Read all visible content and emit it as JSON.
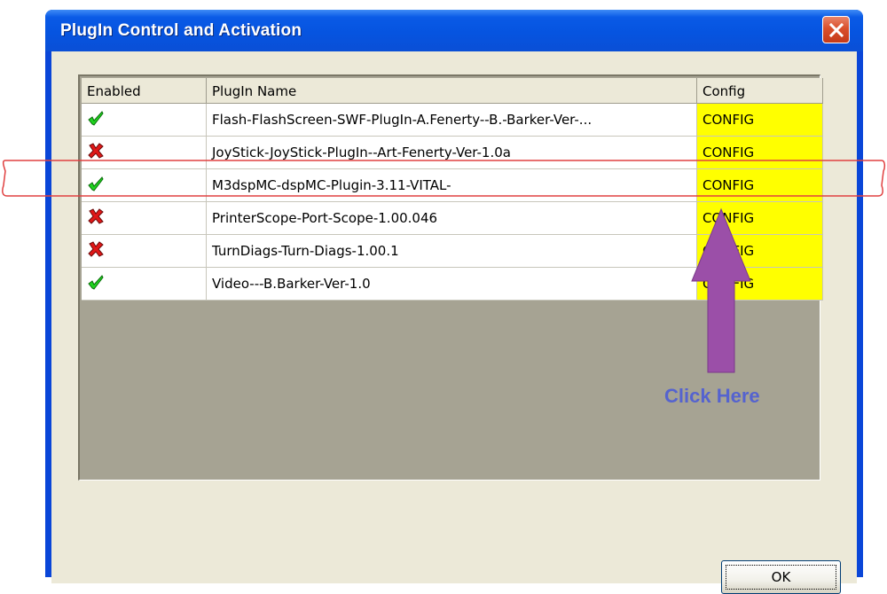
{
  "window": {
    "title": "PlugIn Control and Activation",
    "close_icon": "close-x-icon"
  },
  "grid": {
    "headers": [
      "Enabled",
      "PlugIn Name",
      "Config"
    ],
    "rows": [
      {
        "enabled": true,
        "name": "Flash-FlashScreen-SWF-PlugIn-A.Fenerty--B.-Barker-Ver-...",
        "config": "CONFIG"
      },
      {
        "enabled": false,
        "name": "JoyStick-JoyStick-PlugIn--Art-Fenerty-Ver-1.0a",
        "config": "CONFIG"
      },
      {
        "enabled": true,
        "name": "M3dspMC-dspMC-Plugin-3.11-VITAL-",
        "config": "CONFIG"
      },
      {
        "enabled": false,
        "name": "PrinterScope-Port-Scope-1.00.046",
        "config": "CONFIG"
      },
      {
        "enabled": false,
        "name": "TurnDiags-Turn-Diags-1.00.1",
        "config": "CONFIG"
      },
      {
        "enabled": true,
        "name": "Video---B.Barker-Ver-1.0",
        "config": "CONFIG"
      }
    ],
    "enabled_icon": "green-check-icon",
    "disabled_icon": "red-x-icon",
    "config_bg": "#ffff00"
  },
  "buttons": {
    "ok_label": "OK"
  },
  "annotation": {
    "text": "Click Here",
    "arrow_color": "#9b4fa8",
    "highlight_color": "#e04040"
  }
}
